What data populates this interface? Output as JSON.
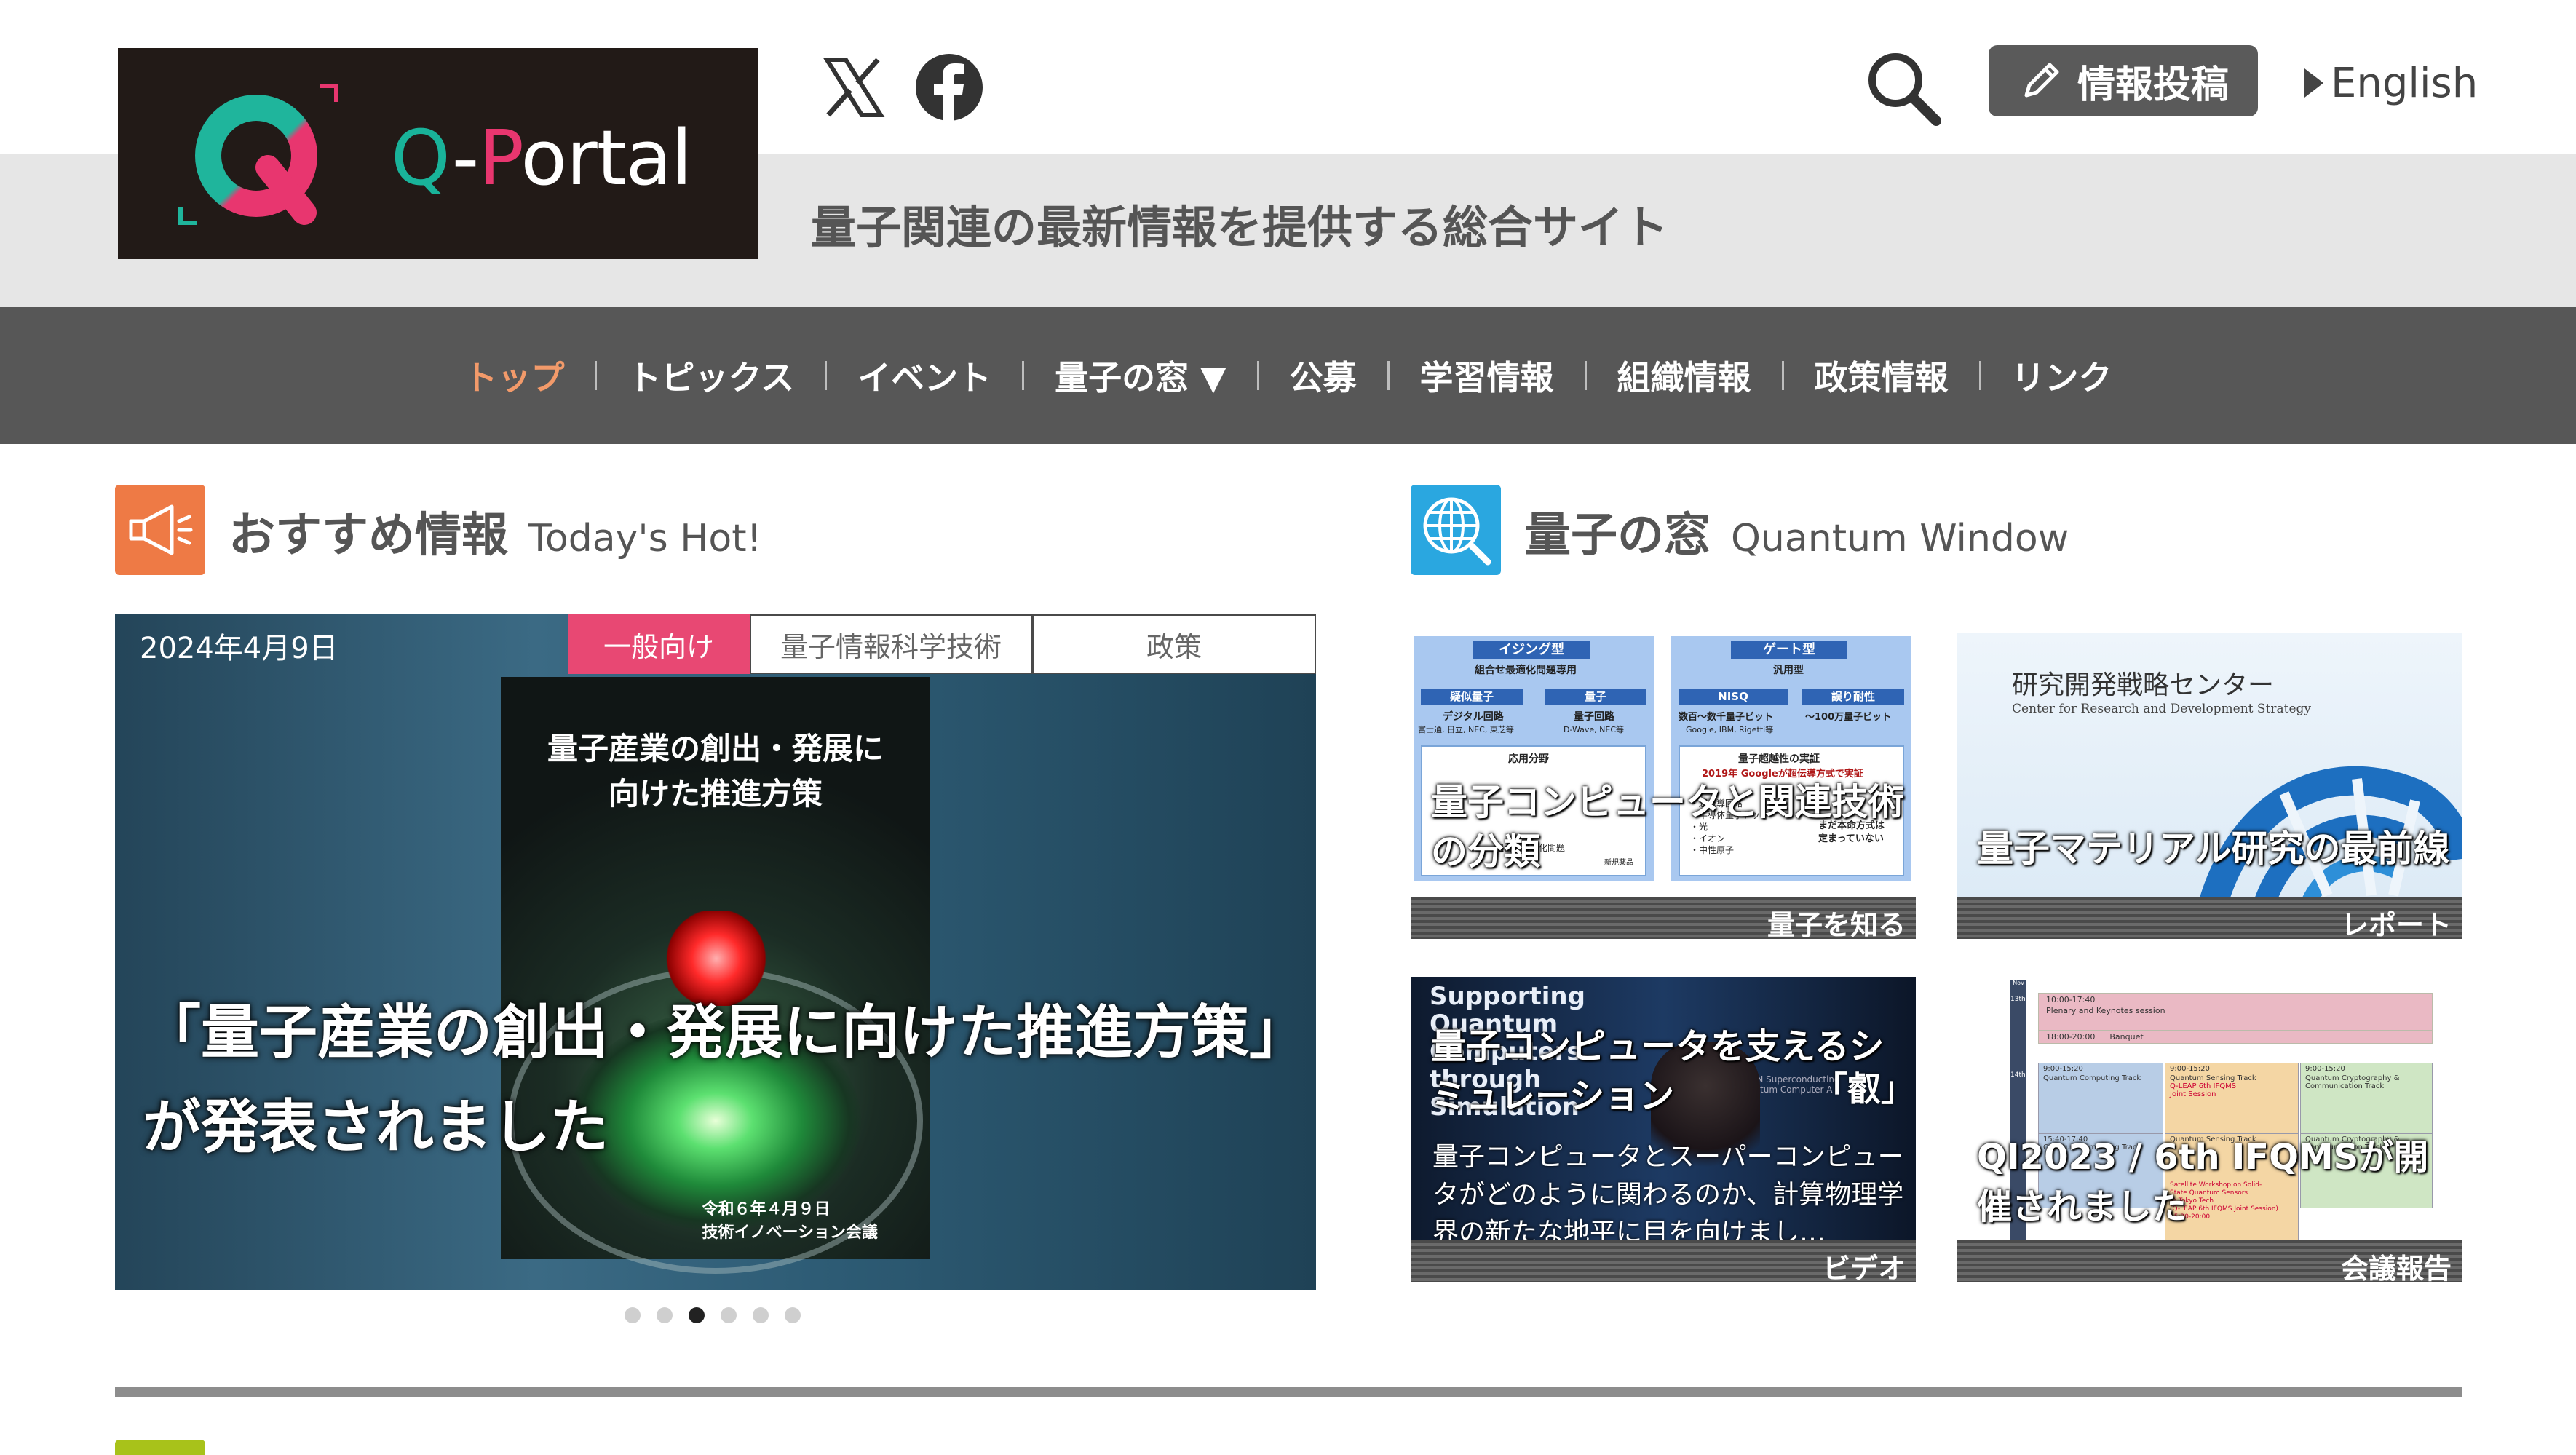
{
  "header": {
    "logo_text_q": "Q",
    "logo_text_dash": "-",
    "logo_text_p": "P",
    "logo_text_rest": "ortal",
    "tagline": "量子関連の最新情報を提供する総合サイト",
    "post_button": "情報投稿",
    "lang_link": "English",
    "icons": [
      "x-icon",
      "facebook-icon",
      "search-icon",
      "pencil-icon"
    ]
  },
  "nav": {
    "items": [
      "トップ",
      "トピックス",
      "イベント",
      "量子の窓 ▼",
      "公募",
      "学習情報",
      "組織情報",
      "政策情報",
      "リンク"
    ],
    "active_index": 0,
    "active_color": "#f29a6a"
  },
  "featured": {
    "title_jp": "おすすめ情報",
    "title_en": "Today's Hot!",
    "icon_color": "#ee7a45",
    "slide": {
      "date": "2024年4月9日",
      "tags": [
        "一般向け",
        "量子情報科学技術",
        "政策"
      ],
      "photo_title_line1": "量子産業の創出・発展に",
      "photo_title_line2": "向けた推進方策",
      "photo_footer_line1": "令和６年４月９日",
      "photo_footer_line2": "技術イノベーション会議",
      "caption": "「量子産業の創出・発展に向けた推進方策」が発表されました"
    },
    "dots_count": 6,
    "active_dot": 2
  },
  "quantum_window": {
    "title_jp": "量子の窓",
    "title_en": "Quantum Window",
    "icon_color": "#2aa7e0",
    "cards": [
      {
        "title_line1": "量子コンピュータと関連技術",
        "title_line2": "の分類",
        "category": "量子を知る",
        "diagram": {
          "left_head": "イジング型",
          "left_sub": "組合せ最適化問題専用",
          "left_a": "疑似量子",
          "left_a_sub": "デジタル回路",
          "left_a_note": "富士通, 日立, NEC, 東芝等",
          "left_b": "量子",
          "left_b_sub": "量子回路",
          "left_b_note": "D-Wave, NEC等",
          "left_app": "応用分野",
          "left_app_sub": "組合せ最適化問題",
          "left_app_icon": "新規薬品",
          "right_head": "ゲート型",
          "right_sub": "汎用型",
          "right_a": "NISQ",
          "right_a_sub": "数百～数千量子ビット",
          "right_a_note": "Google, IBM, Rigetti等",
          "right_b": "誤り耐性",
          "right_b_sub": "～100万量子ビット",
          "right_mid": "量子超越性の実証",
          "right_mid_sub": "2019年 Googleが超伝導方式で実証",
          "right_list": [
            "・超伝導回路",
            "・半導体量子ドット",
            "・光",
            "・イオン",
            "・中性原子"
          ],
          "right_undecided": "まだ本命方式は",
          "right_undecided2": "定まっていない"
        }
      },
      {
        "title_line1": "量子マテリアル研究の最前線",
        "category": "レポート",
        "center_jp": "研究開発戦略センター",
        "center_en": "Center for Research and Development Strategy"
      },
      {
        "title_line1": "量子コンピュータを支えるシ",
        "title_line2": "ミュレーション",
        "subtitle": "量子コンピュータとスーパーコンピュータがどのように関わるのか、計算物理学界の新たな地平に目を向けまし…",
        "category": "ビデオ",
        "image_text_line1": "Supporting",
        "image_text_line2": "Quantum",
        "image_text_line3": "Computers",
        "image_text_line4": "through",
        "image_text_line5": "Simulation",
        "image_text_small1": "RIKEN Superconducting",
        "image_text_small2": "Quantum Computer A",
        "badge": "「叡」"
      },
      {
        "title_line1": "QI2023 / 6th IFQMSが開",
        "title_line2": "催されました",
        "category": "会議報告",
        "schedule": {
          "day_label": "Nov",
          "row1_day": "13th",
          "row1": "10:00-17:40",
          "row1b": "Plenary and Keynotes session",
          "row2": "18:00-20:00",
          "row2b": "Banquet",
          "row3_day": "14th",
          "row3a": "9:00-15:20",
          "row3a_b": "Quantum Computing Track",
          "row3b": "9:00-15:20",
          "row3b_b": "Quantum Sensing Track",
          "row3b_c": "Q-LEAP 6th IFQMS",
          "row3b_d": "Joint Session",
          "row3c": "9:00-15:20",
          "row3c_b": "Quantum Cryptography &",
          "row3c_c": "Communication Track",
          "row4a": "15:40-17:40",
          "row4a_b": "Quantum Computing Track",
          "row4b": "Quantum Sensing Track",
          "row4c": "Quantum Cryptography &",
          "row4c_b": "Communication Track",
          "row5": "Satellite Workshop on Solid-",
          "row5b": "State Quantum Sensors",
          "row5c": "@ Tokyo Tech",
          "row5d": "(Q-LEAP 6th IFQMS Joint Session)",
          "row5e": "15:20-20:00"
        }
      }
    ]
  }
}
